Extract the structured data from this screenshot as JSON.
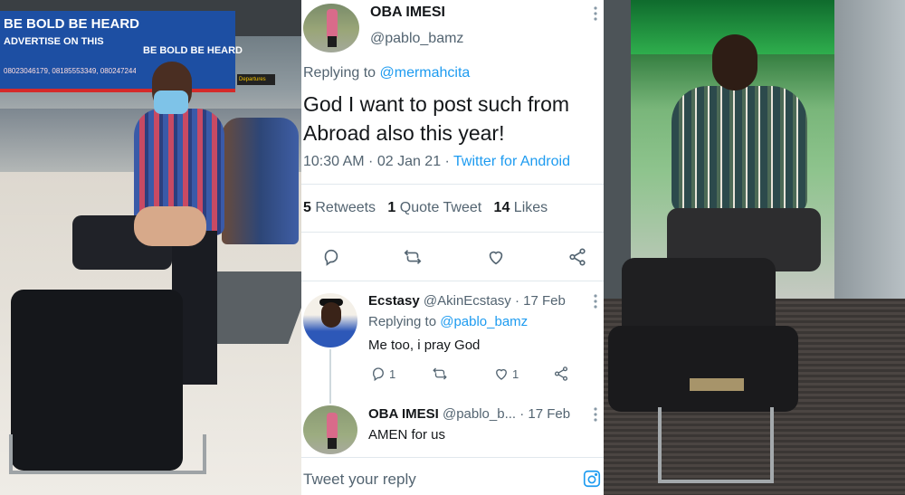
{
  "left_photo": {
    "banner_line1": "BE BOLD  BE HEARD",
    "banner_line2": "ADVERTISE ON THIS",
    "banner_phone": "08023046179, 08185553349, 08024724484",
    "banner2_text": "BE BOLD  BE HEARD",
    "sign_text": "Departures"
  },
  "tweet": {
    "author_name": "OBA IMESI",
    "author_handle": "@pablo_bamz",
    "replying_label": "Replying to",
    "replying_handle": "@mermahcita",
    "text": "God I want to post such from Abroad also this year!",
    "time": "10:30 AM · 02 Jan 21 · ",
    "source": "Twitter for Android",
    "retweets_count": "5",
    "retweets_label": "Retweets",
    "quotes_count": "1",
    "quotes_label": "Quote Tweet",
    "likes_count": "14",
    "likes_label": "Likes",
    "more_icon": "more-vertical-icon"
  },
  "replies": [
    {
      "name": "Ecstasy",
      "handle": "@AkinEcstasy · 17 Feb",
      "replying_label": "Replying to",
      "replying_handle": "@pablo_bamz",
      "text": "Me too, i pray God",
      "reply_count": "1",
      "like_count": "1"
    },
    {
      "name": "OBA IMESI",
      "handle": "@pablo_b... · 17 Feb",
      "text": "AMEN for us"
    }
  ],
  "compose": {
    "placeholder": "Tweet your reply"
  },
  "colors": {
    "link": "#1d9bf0",
    "secondary_text": "#536471",
    "primary_text": "#14171a"
  }
}
